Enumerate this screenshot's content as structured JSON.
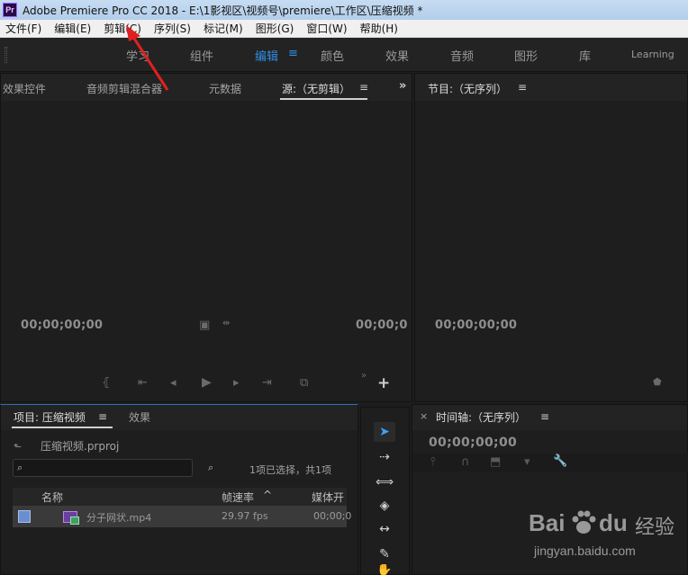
{
  "app": {
    "icon_label": "Pr",
    "title": "Adobe Premiere Pro CC 2018 - E:\\1影视区\\视频号\\premiere\\工作区\\压缩视频 *"
  },
  "menu": {
    "items": [
      "文件(F)",
      "编辑(E)",
      "剪辑(C)",
      "序列(S)",
      "标记(M)",
      "图形(G)",
      "窗口(W)",
      "帮助(H)"
    ]
  },
  "workspaces": {
    "tabs": [
      "学习",
      "组件",
      "编辑",
      "颜色",
      "效果",
      "音频",
      "图形",
      "库",
      "Learning"
    ],
    "active": "编辑",
    "menu_glyph": "≡"
  },
  "source_panel": {
    "tabs": [
      "效果控件",
      "音频剪辑混合器",
      "元数据",
      "源:（无剪辑）"
    ],
    "active_tab": "源:（无剪辑）",
    "menu_glyph": "≡",
    "overflow_glyph": "»",
    "timecode_left": "00;00;00;00",
    "timecode_right": "00;00;0"
  },
  "program_panel": {
    "tab": "节目:（无序列）",
    "menu_glyph": "≡",
    "timecode": "00;00;00;00"
  },
  "project_panel": {
    "tabs": [
      "项目: 压缩视频",
      "效果"
    ],
    "active_tab": "项目: 压缩视频",
    "menu_glyph": "≡",
    "project_file": "压缩视频.prproj",
    "search": {
      "value": "",
      "placeholder": ""
    },
    "selection_status": "1项已选择，共1项",
    "columns": [
      "名称",
      "帧速率",
      "媒体开"
    ],
    "sort_glyph": "^",
    "rows": [
      {
        "name": "分子网状.mp4",
        "frame_rate": "29.97 fps",
        "media_start": "00;00;0"
      }
    ]
  },
  "timeline_panel": {
    "close_glyph": "×",
    "tab": "时间轴:（无序列）",
    "menu_glyph": "≡",
    "timecode": "00;00;00;00"
  },
  "watermark": {
    "brand_left": "Bai",
    "brand_right": "du",
    "suffix": "经验",
    "url": "jingyan.baidu.com"
  },
  "colors": {
    "accent": "#2e8fe6",
    "annotation_arrow": "#e02020"
  }
}
